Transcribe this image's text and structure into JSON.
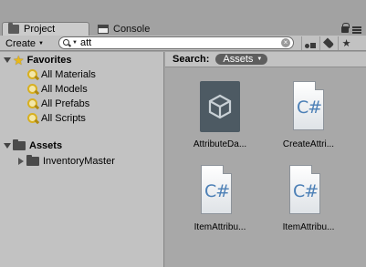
{
  "tabs": [
    {
      "label": "Project",
      "icon": "folder-icon",
      "active": true
    },
    {
      "label": "Console",
      "icon": "console-icon",
      "active": false
    }
  ],
  "toolbar": {
    "create_label": "Create",
    "search_value": "att"
  },
  "tree": {
    "favorites_label": "Favorites",
    "favorites": [
      "All Materials",
      "All Models",
      "All Prefabs",
      "All Scripts"
    ],
    "assets_label": "Assets",
    "assets_children": [
      "InventoryMaster"
    ]
  },
  "search_scope": {
    "label": "Search:",
    "scope": "Assets"
  },
  "assets": [
    {
      "label": "AttributeDa...",
      "icon": "unity-asset-icon"
    },
    {
      "label": "CreateAttri...",
      "icon": "csharp-script-icon"
    },
    {
      "label": "ItemAttribu...",
      "icon": "csharp-script-icon"
    },
    {
      "label": "ItemAttribu...",
      "icon": "csharp-script-icon"
    }
  ],
  "colors": {
    "background": "#a2a2a2",
    "panel": "#c2c2c2",
    "grid": "#a8a8a8",
    "scope_pill": "#5e5e5e",
    "favorite_star": "#e8b818"
  }
}
